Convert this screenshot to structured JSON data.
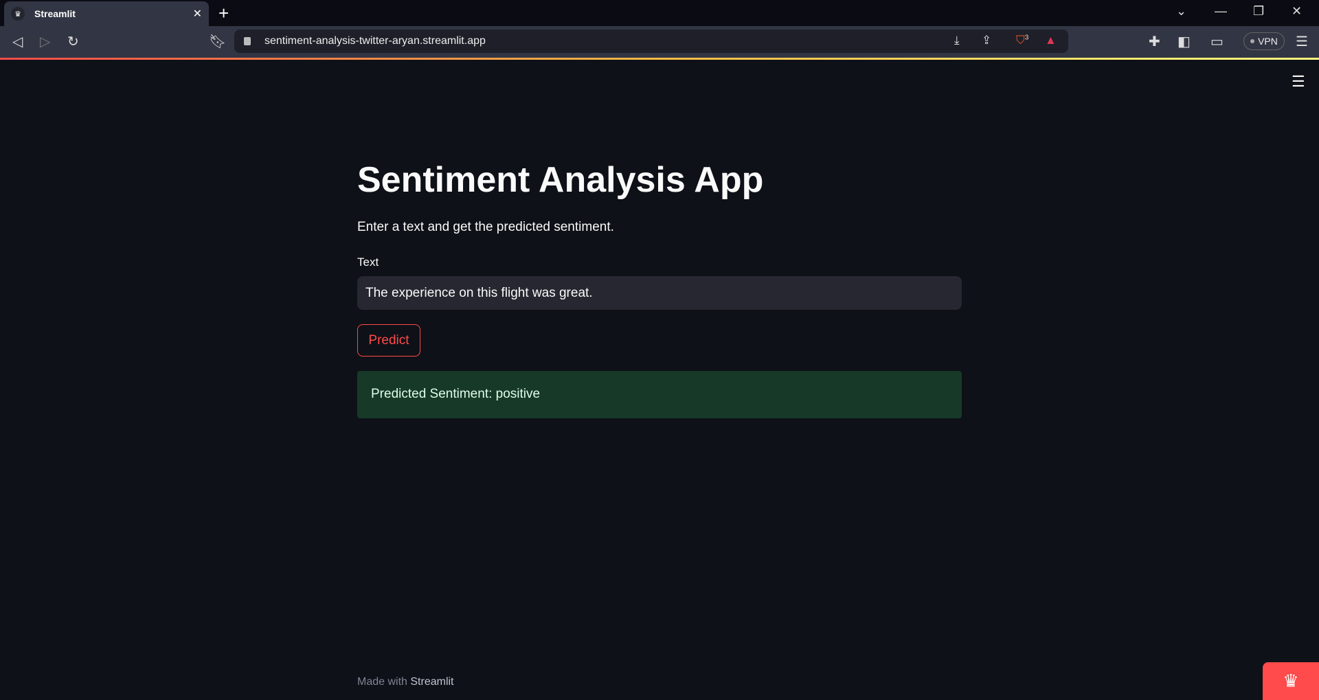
{
  "browser": {
    "tab_title": "Streamlit",
    "url": "sentiment-analysis-twitter-aryan.streamlit.app",
    "shields_count": "3",
    "vpn_label": "VPN"
  },
  "app": {
    "title": "Sentiment Analysis App",
    "subtitle": "Enter a text and get the predicted sentiment.",
    "input_label": "Text",
    "input_value": "The experience on this flight was great.",
    "predict_label": "Predict",
    "result": "Predicted Sentiment: positive",
    "footer_prefix": "Made with",
    "footer_brand": "Streamlit"
  },
  "colors": {
    "primary": "#ff4b4b",
    "background": "#0e1117",
    "success_bg": "#173928"
  }
}
